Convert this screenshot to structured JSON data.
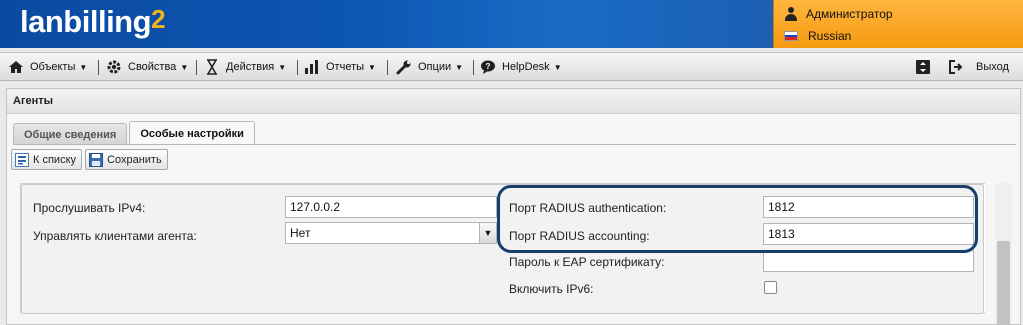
{
  "header": {
    "logo_text": "lanbilling",
    "logo_sup": "2",
    "user": "Администратор",
    "language": "Russian"
  },
  "menu": {
    "items": [
      {
        "label": "Объекты",
        "icon": "building-icon"
      },
      {
        "label": "Свойства",
        "icon": "gear-icon"
      },
      {
        "label": "Действия",
        "icon": "hourglass-icon"
      },
      {
        "label": "Отчеты",
        "icon": "bar-chart-icon"
      },
      {
        "label": "Опции",
        "icon": "wrench-icon"
      },
      {
        "label": "HelpDesk",
        "icon": "chat-icon"
      }
    ],
    "logout": "Выход"
  },
  "panel": {
    "title": "Агенты",
    "tabs": [
      {
        "label": "Общие сведения",
        "active": false
      },
      {
        "label": "Особые настройки",
        "active": true
      }
    ],
    "toolbar": {
      "back_label": "К списку",
      "save_label": "Сохранить"
    }
  },
  "form": {
    "listen_ipv4_label": "Прослушивать IPv4:",
    "listen_ipv4_value": "127.0.0.2",
    "manage_clients_label": "Управлять клиентами агента:",
    "manage_clients_value": "Нет",
    "radius_auth_label": "Порт RADIUS authentication:",
    "radius_auth_value": "1812",
    "radius_acct_label": "Порт RADIUS accounting:",
    "radius_acct_value": "1813",
    "eap_password_label": "Пароль к EAP сертификату:",
    "eap_password_value": "",
    "ipv6_label": "Включить IPv6:",
    "ipv6_enabled": false
  },
  "colors": {
    "header_blue": "#0d56b4",
    "user_panel_orange": "#f9a623",
    "highlight_ring": "#163f6e",
    "logo_accent": "#f2b418"
  }
}
